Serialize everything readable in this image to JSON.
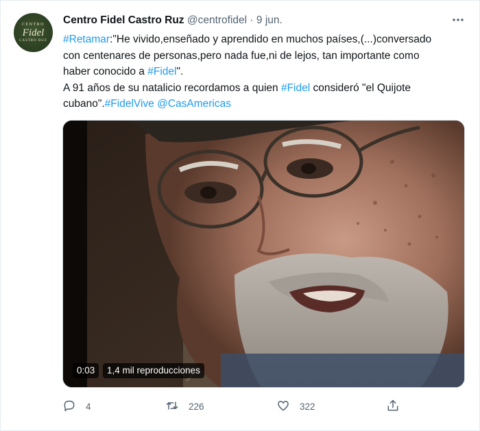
{
  "tweet": {
    "author_name": "Centro Fidel Castro Ruz",
    "author_handle": "@centrofidel",
    "separator": "·",
    "date": "9 jun.",
    "more_icon": "more-horizontal-icon",
    "avatar_text": {
      "top": "CENTRO",
      "middle": "Fidel",
      "bottom": "CASTRO RUZ"
    },
    "text_lines": [
      [
        {
          "t": "#Retamar",
          "link": true
        },
        {
          "t": ":\"He vivido,enseñado y aprendido en muchos países,(...)conversado",
          "link": false
        }
      ],
      [
        {
          "t": "con centenares de personas,pero nada fue,ni de lejos, tan importante como",
          "link": false
        }
      ],
      [
        {
          "t": "haber conocido a ",
          "link": false
        },
        {
          "t": "#Fidel",
          "link": true
        },
        {
          "t": "\".",
          "link": false
        }
      ],
      [
        {
          "t": "A 91 años de su natalicio recordamos a quien ",
          "link": false
        },
        {
          "t": "#Fidel",
          "link": true
        },
        {
          "t": " consideró \"el Quijote",
          "link": false
        }
      ],
      [
        {
          "t": "cubano\".",
          "link": false
        },
        {
          "t": "#FidelVive",
          "link": true
        },
        {
          "t": " ",
          "link": false
        },
        {
          "t": "@CasAmericas",
          "link": true
        }
      ]
    ],
    "video": {
      "elapsed": "0:03",
      "views": "1,4 mil reproducciones"
    },
    "actions": {
      "reply_count": "4",
      "retweet_count": "226",
      "like_count": "322",
      "reply_icon": "reply-icon",
      "retweet_icon": "retweet-icon",
      "like_icon": "heart-icon",
      "share_icon": "share-icon"
    },
    "colors": {
      "link": "#1d9bf0",
      "secondary_text": "#536471",
      "primary_text": "#0f1419"
    }
  }
}
